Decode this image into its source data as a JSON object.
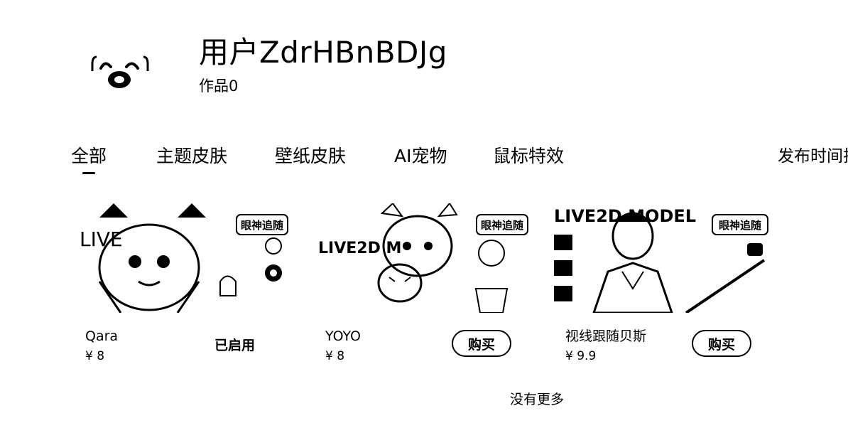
{
  "profile": {
    "username": "用户ZdrHBnBDJg",
    "works": "作品0",
    "avatar_icon": "smiling-face-icon"
  },
  "tabs": [
    {
      "label": "全部",
      "active": true
    },
    {
      "label": "主题皮肤",
      "active": false
    },
    {
      "label": "壁纸皮肤",
      "active": false
    },
    {
      "label": "AI宠物",
      "active": false
    },
    {
      "label": "鼠标特效",
      "active": false
    }
  ],
  "sort": {
    "label": "发布时间排"
  },
  "items": [
    {
      "name": "Qara",
      "price": "¥ 8",
      "status": "已启用",
      "badge": "眼神追随",
      "art_text": "LIVE"
    },
    {
      "name": "YOYO",
      "price": "¥ 8",
      "button": "购买",
      "badge": "眼神追随",
      "art_text": "LIVE2D M"
    },
    {
      "name": "视线跟随贝斯",
      "price": "¥ 9.9",
      "button": "购买",
      "badge": "眼神追随",
      "art_text": "LIVE2D MODEL"
    }
  ],
  "footer": "没有更多"
}
